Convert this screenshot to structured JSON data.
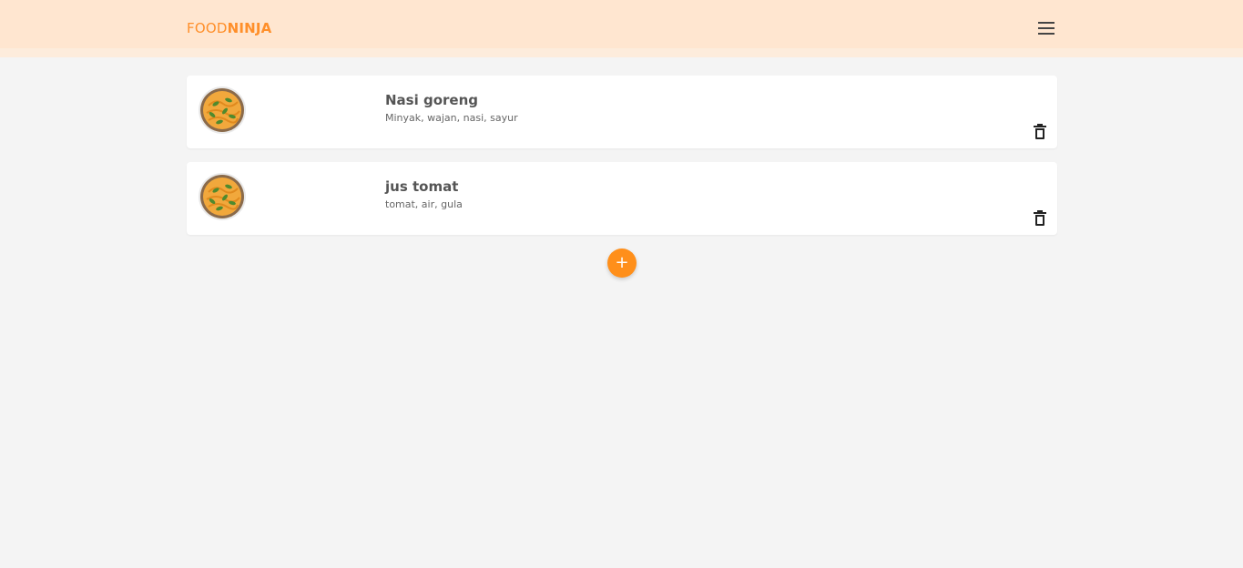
{
  "navbar": {
    "brand_light": "FOOD",
    "brand_bold": "NINJA",
    "menu_icon": "menu-icon"
  },
  "recipes": [
    {
      "title": "Nasi goreng",
      "ingredients": "Minyak, wajan, nasi, sayur",
      "image_icon": "noodle-bowl-icon",
      "delete_icon": "trash-icon"
    },
    {
      "title": "jus tomat",
      "ingredients": "tomat, air, gula",
      "image_icon": "noodle-bowl-icon",
      "delete_icon": "trash-icon"
    }
  ],
  "add_button": {
    "label": "+"
  },
  "colors": {
    "navbar_bg": "#ffe6d0",
    "brand": "#ff8f2a",
    "accent": "#ff8f1a",
    "page_bg": "#f4f4f4"
  }
}
